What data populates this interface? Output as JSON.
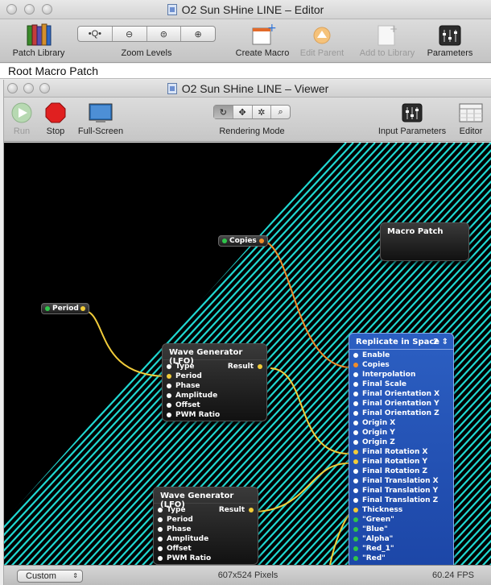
{
  "editor": {
    "title": "O2 Sun SHine LINE – Editor",
    "toolbar": {
      "patch_library": "Patch Library",
      "zoom_levels": "Zoom Levels",
      "zoom_buttons": [
        "•Q•",
        "Q",
        "Q",
        "Q"
      ],
      "create_macro": "Create Macro",
      "edit_parent": "Edit Parent",
      "add_to_library": "Add to Library",
      "parameters": "Parameters"
    },
    "breadcrumb": "Root Macro Patch"
  },
  "viewer": {
    "title": "O2 Sun SHine LINE – Viewer",
    "toolbar": {
      "run": "Run",
      "stop": "Stop",
      "full_screen": "Full-Screen",
      "rendering_mode": "Rendering Mode",
      "input_parameters": "Input Parameters",
      "editor": "Editor"
    },
    "status": {
      "popup_value": "Custom",
      "dimensions": "607x524 Pixels",
      "fps": "60.24 FPS"
    }
  },
  "patches": {
    "copies_node": "Copies",
    "period_node": "Period",
    "macro_patch": "Macro Patch",
    "wave1": {
      "title": "Wave Generator (LFO)",
      "inputs": [
        "Type",
        "Period",
        "Phase",
        "Amplitude",
        "Offset",
        "PWM Ratio"
      ],
      "output": "Result"
    },
    "wave2": {
      "title": "Wave Generator (LFO)",
      "inputs": [
        "Type",
        "Period",
        "Phase",
        "Amplitude",
        "Offset",
        "PWM Ratio"
      ],
      "output": "Result"
    },
    "replicate": {
      "title": "Replicate in Space",
      "badge": "2",
      "inputs": [
        "Enable",
        "Copies",
        "Interpolation",
        "Final Scale",
        "Final Orientation X",
        "Final Orientation Y",
        "Final Orientation Z",
        "Origin X",
        "Origin Y",
        "Origin Z",
        "Final Rotation X",
        "Final Rotation Y",
        "Final Rotation Z",
        "Final Translation X",
        "Final Translation Y",
        "Final Translation Z",
        "Thickness",
        "\"Green\"",
        "\"Blue\"",
        "\"Alpha\"",
        "\"Red_1\"",
        "\"Red\""
      ]
    }
  },
  "colors": {
    "line_cyan": "#20d8d2",
    "cable_yellow": "#f1cc3a",
    "cable_orange": "#f08d2a",
    "replicate_blue": "#2453b8"
  }
}
